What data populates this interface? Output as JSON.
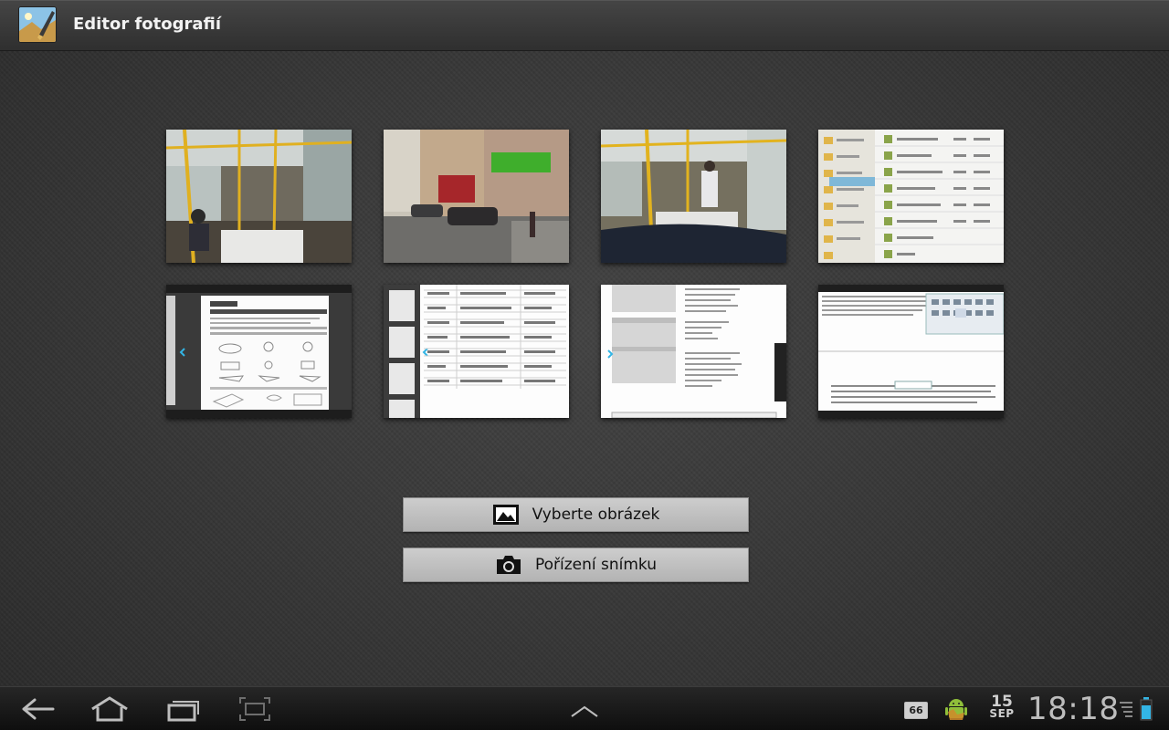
{
  "app": {
    "title": "Editor fotografií",
    "icon": "photo-editor-icon"
  },
  "gallery": {
    "thumbnails": [
      {
        "name": "tram-interior-photo",
        "kind": "photo"
      },
      {
        "name": "street-photo",
        "kind": "photo"
      },
      {
        "name": "tram-interior-photo-2",
        "kind": "photo"
      },
      {
        "name": "file-manager-screenshot",
        "kind": "screenshot"
      },
      {
        "name": "document-screenshot",
        "kind": "screenshot"
      },
      {
        "name": "table-screenshot",
        "kind": "screenshot"
      },
      {
        "name": "catalog-screenshot",
        "kind": "screenshot"
      },
      {
        "name": "text-editor-screenshot",
        "kind": "screenshot"
      }
    ]
  },
  "actions": {
    "select_image": "Vyberte obrázek",
    "select_icon": "picture-icon",
    "capture": "Pořízení snímku",
    "capture_icon": "camera-icon"
  },
  "system_bar": {
    "back_icon": "back-icon",
    "home_icon": "home-icon",
    "recent_icon": "recent-apps-icon",
    "screenshot_icon": "screenshot-icon",
    "menu_icon": "chevron-up-icon",
    "notification_count": "66",
    "date_day": "15",
    "date_month": "SEP",
    "time": "18:18",
    "colors": {
      "bar": "#1a1a1a",
      "battery": "#33b5e5"
    }
  }
}
